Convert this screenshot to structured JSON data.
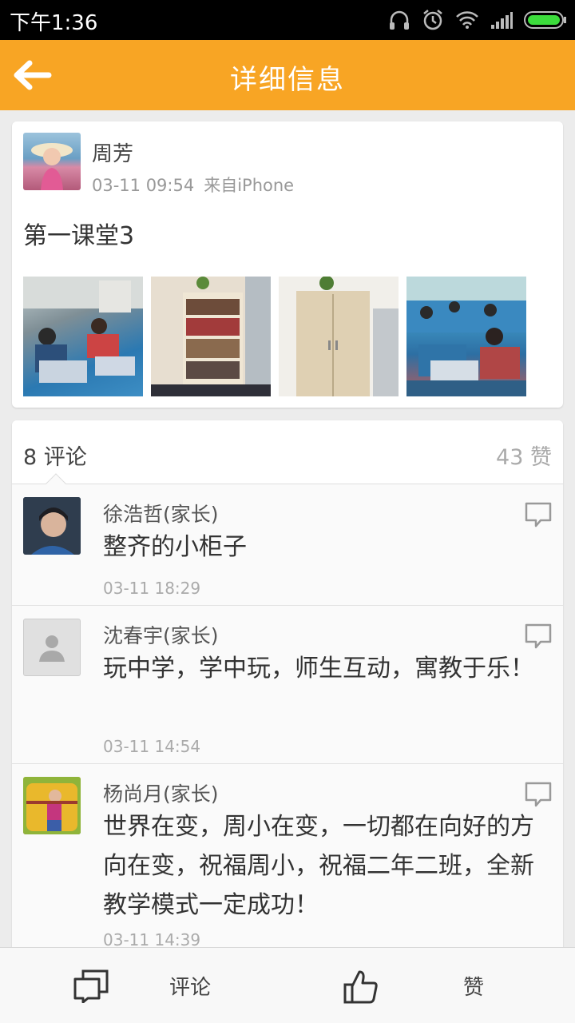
{
  "status_bar": {
    "time": "下午1:36"
  },
  "header": {
    "title": "详细信息"
  },
  "post": {
    "author": "周芳",
    "date": "03-11 09:54",
    "source": "来自iPhone",
    "text": "第一课堂3"
  },
  "comments_section": {
    "comment_count": "8 评论",
    "like_count": "43 赞"
  },
  "comments": [
    {
      "name": "徐浩哲(家长)",
      "text": "整齐的小柜子",
      "time": "03-11 18:29"
    },
    {
      "name": "沈春宇(家长)",
      "text": "玩中学，学中玩，师生互动，寓教于乐！",
      "time": "03-11 14:54"
    },
    {
      "name": "杨尚月(家长)",
      "text": "世界在变，周小在变，一切都在向好的方向在变，祝福周小，祝福二年二班，全新教学模式一定成功！",
      "time": "03-11 14:39"
    }
  ],
  "bottom_bar": {
    "comment_label": "评论",
    "like_label": "赞"
  },
  "colors": {
    "accent": "#f8a524",
    "status_bar": "#000000"
  }
}
